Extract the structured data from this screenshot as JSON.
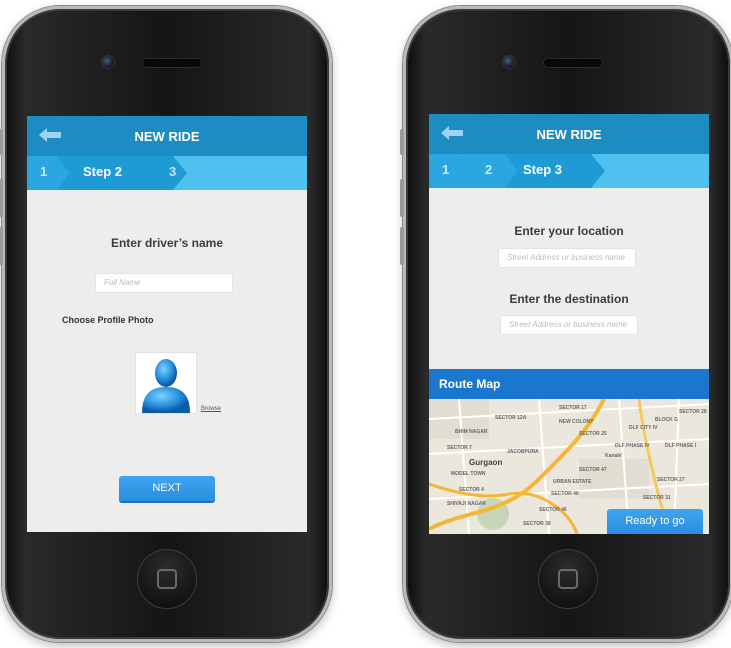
{
  "screens": {
    "left": {
      "title": "NEW RIDE",
      "steps": [
        "1",
        "Step 2",
        "3"
      ],
      "driver_name_label": "Enter driver’s name",
      "driver_name_placeholder": "Full Name",
      "profile_photo_label": "Choose Profile Photo",
      "browse_link": "Browse",
      "next_button": "NEXT"
    },
    "right": {
      "title": "NEW RIDE",
      "steps": [
        "1",
        "2",
        "Step 3"
      ],
      "location_label": "Enter your location",
      "location_placeholder": "Street Address or business name",
      "destination_label": "Enter the destination",
      "destination_placeholder": "Street Address or business name",
      "route_map_title": "Route Map",
      "ready_button": "Ready to go",
      "map": {
        "city": "Gurgaon",
        "labels": [
          "SECTOR 17",
          "SECTOR 12A",
          "BHIM NAGAR",
          "SECTOR 7",
          "JACOBPURA",
          "MODEL TOWN",
          "SECTOR 4",
          "SECTOR 47",
          "SECTOR 40",
          "SECTOR 46",
          "DLF PHASE IV",
          "DLF PHASE I",
          "SECTOR 28",
          "URBAN ESTATE",
          "SHIVAJI NAGAR",
          "Kanahi",
          "SECTOR 38",
          "SECTOR 31",
          "DLF CITY IV",
          "BLOCK G",
          "SECTOR 25",
          "SECTOR 27",
          "NEW COLONY"
        ]
      }
    }
  },
  "colors": {
    "topbar": "#1c8dc2",
    "stepbar": "#4fc1ef",
    "active_step": "#1e9bd5",
    "button": "#2b8ee0",
    "route_bar": "#1a76cf"
  }
}
